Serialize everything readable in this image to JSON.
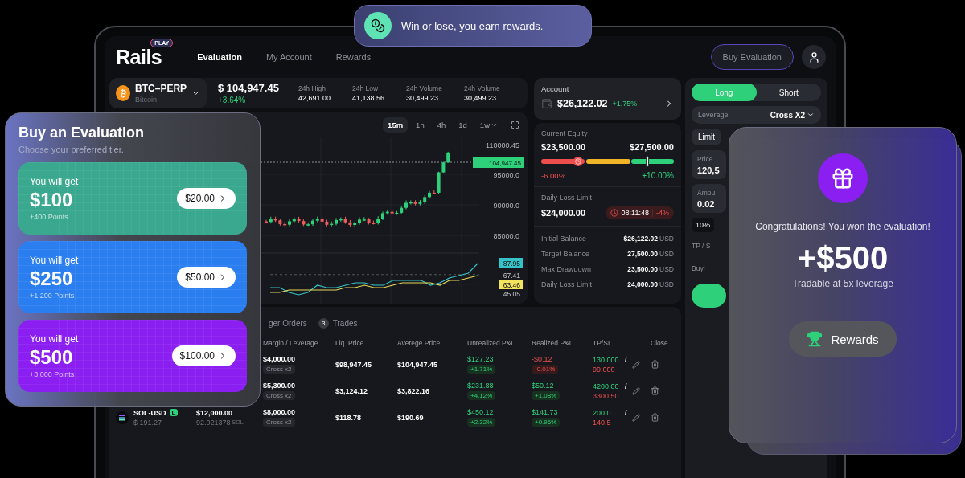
{
  "banner": {
    "text": "Win or lose, you earn rewards."
  },
  "header": {
    "logo": "Rails",
    "logo_badge": "PLAY",
    "nav": [
      {
        "label": "Evaluation",
        "selected": true
      },
      {
        "label": "My Account",
        "selected": false
      },
      {
        "label": "Rewards",
        "selected": false
      }
    ],
    "buy_button": "Buy Evaluation"
  },
  "market": {
    "symbol": "BTC–PERP",
    "name": "Bitcoin",
    "price": "$ 104,947.45",
    "change": "+3.64%",
    "stats": [
      {
        "label": "24h High",
        "value": "42,691.00"
      },
      {
        "label": "24h Low",
        "value": "41,138.56"
      },
      {
        "label": "24h Volume",
        "value": "30,499.23"
      },
      {
        "label": "24h Volume",
        "value": "30,499.23"
      }
    ]
  },
  "chart": {
    "timeframes": [
      {
        "label": "15m",
        "selected": true,
        "dropdown": false
      },
      {
        "label": "1h",
        "selected": false,
        "dropdown": false
      },
      {
        "label": "4h",
        "selected": false,
        "dropdown": false
      },
      {
        "label": "1d",
        "selected": false,
        "dropdown": false
      },
      {
        "label": "1w",
        "selected": false,
        "dropdown": true
      }
    ],
    "price_labels": [
      "110000.45",
      "95000.0",
      "90000.0",
      "85000.0"
    ],
    "last_price": "104,947.45",
    "chart_data": {
      "type": "line",
      "ylim": [
        56,
        76
      ],
      "yticks": [
        63.46,
        67.41
      ],
      "series": [
        {
          "color": "#35c3c7",
          "values": [
            62,
            62,
            60,
            59,
            60,
            63,
            62,
            62,
            63,
            64,
            64,
            63,
            63,
            65,
            65,
            65,
            65,
            63,
            64,
            66,
            67,
            68,
            72
          ]
        },
        {
          "color": "#e6d85a",
          "values": [
            60,
            60,
            61,
            61,
            61,
            61,
            61,
            61,
            62,
            62,
            63,
            62,
            62,
            63,
            64,
            64,
            64,
            64,
            63,
            65,
            65,
            66,
            67
          ]
        }
      ]
    },
    "indicator_labels": [
      {
        "text": "87.95",
        "kind": "tag",
        "color": "#35c3c7"
      },
      {
        "text": "67.41",
        "kind": "plain"
      },
      {
        "text": "63.46",
        "kind": "tag",
        "color": "#f3e45d"
      },
      {
        "text": "45.05",
        "kind": "plain"
      }
    ]
  },
  "account": {
    "title": "Account",
    "balance": "$26,122.02",
    "change": "+1.75%"
  },
  "equity": {
    "title": "Current Equity",
    "low": "$23,500.00",
    "high": "$27,500.00",
    "low_pct": "-6.00%",
    "high_pct": "+10.00%",
    "level": 0.8,
    "daily_title": "Daily Loss Limit",
    "daily_value": "$24,000.00",
    "timer": "08:11:48",
    "timer_pct": "-4%",
    "rows": [
      {
        "label": "Initial Balance",
        "value": "$26,122.02",
        "unit": "USD"
      },
      {
        "label": "Target Balance",
        "value": "27,500.00",
        "unit": "USD"
      },
      {
        "label": "Max Drawdown",
        "value": "23,500.00",
        "unit": "USD"
      },
      {
        "label": "Daily Loss Limit",
        "value": "24,000.00",
        "unit": "USD"
      }
    ]
  },
  "order": {
    "sides": [
      {
        "label": "Long",
        "selected": true
      },
      {
        "label": "Short",
        "selected": false
      }
    ],
    "leverage_label": "Leverage",
    "leverage_value": "Cross X2",
    "types": [
      {
        "label": "Limit",
        "selected": true
      }
    ],
    "fields": [
      {
        "label": "Price",
        "value": "120,5"
      },
      {
        "label": "Amou",
        "value": "0.02"
      }
    ],
    "percent": "10%",
    "tpsl_label": "TP / S",
    "buying_label": "Buyi"
  },
  "positions": {
    "tabs": [
      {
        "label": "ger Orders"
      },
      {
        "count": "3",
        "label": "Trades"
      }
    ],
    "columns": [
      "Margin / Leverage",
      "Liq. Price",
      "Averege Price",
      "Unrealized P&L",
      "Realized P&L",
      "TP/SL",
      "Close"
    ],
    "rows": [
      {
        "margin": "$4,000.00",
        "leverage": "Cross x2",
        "liq": "$98,947.45",
        "avg": "$104,947.45",
        "unrealized": {
          "value": "$127.23",
          "pct": "+1.71%",
          "positive": true
        },
        "realized": {
          "value": "-$0.12",
          "pct": "-0.01%",
          "positive": false
        },
        "tp": "130.000",
        "separator": "/",
        "sl": "99.000"
      },
      {
        "margin": "$5,300.00",
        "leverage": "Cross x2",
        "liq": "$3,124.12",
        "avg": "$3,822.16",
        "unrealized": {
          "value": "$231.88",
          "pct": "+4.12%",
          "positive": true
        },
        "realized": {
          "value": "$50.12",
          "pct": "+1.08%",
          "positive": true
        },
        "tp": "4200.00",
        "separator": "/",
        "sl": "3300.50"
      },
      {
        "market": "SOL-USD",
        "side": "L",
        "mark": "$ 191.27",
        "size": "$12,000.00",
        "size_units": "92.021378",
        "size_unit": "SOL",
        "margin": "$8,000.00",
        "leverage": "Cross x2",
        "liq": "$118.78",
        "avg": "$190.69",
        "unrealized": {
          "value": "$450.12",
          "pct": "+2.32%",
          "positive": true
        },
        "realized": {
          "value": "$141.73",
          "pct": "+0.96%",
          "positive": true
        },
        "tp": "200.0",
        "separator": "/",
        "sl": "140.5"
      }
    ]
  },
  "buy_card": {
    "title": "Buy an Evaluation",
    "subtitle": "Choose your preferred tier.",
    "tiers": [
      {
        "caption": "You will get",
        "amount": "$100",
        "points": "+400 Points",
        "price": "$20.00",
        "color": "#3aa88e"
      },
      {
        "caption": "You will get",
        "amount": "$250",
        "points": "+1,200 Points",
        "price": "$50.00",
        "color": "#2a7ef0"
      },
      {
        "caption": "You will get",
        "amount": "$500",
        "points": "+3,000 Points",
        "price": "$100.00",
        "color": "#8b1ff2"
      }
    ]
  },
  "reward_card": {
    "message": "Congratulations! You won the evaluation!",
    "amount": "+$500",
    "note": "Tradable at 5x leverage",
    "button": "Rewards"
  }
}
